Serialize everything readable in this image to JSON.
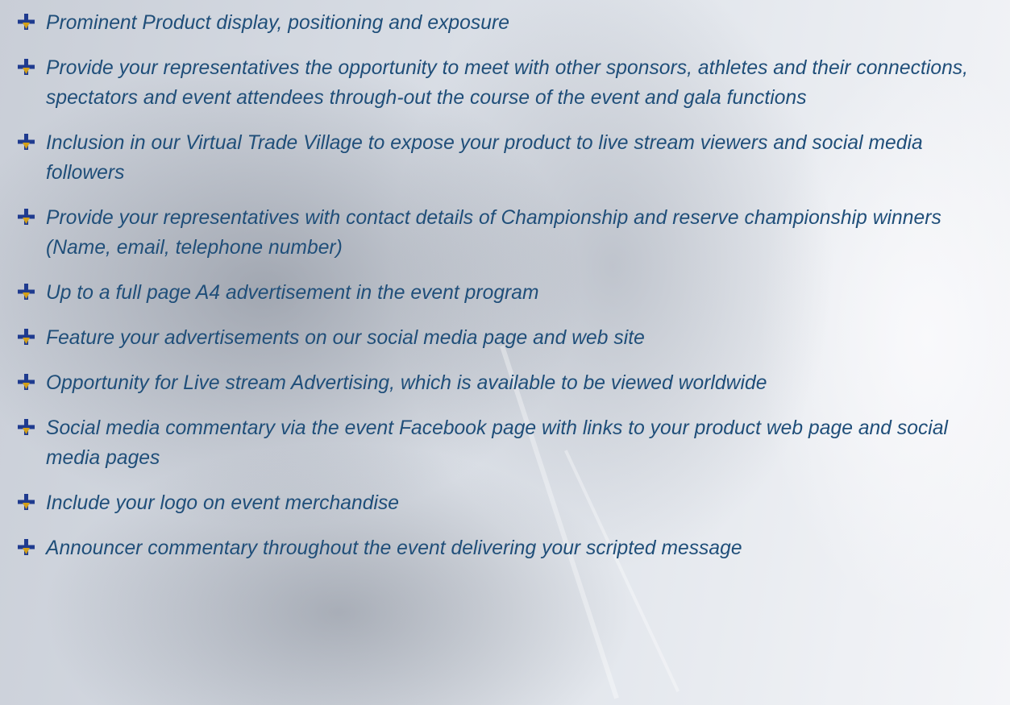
{
  "bullet_icon": "arrow-down-plus-bullet-icon",
  "colors": {
    "text": "#1f4e79",
    "bullet_plus": "#1f3b8f",
    "bullet_arrow": "#d4a017"
  },
  "items": [
    {
      "text": "Prominent Product display, positioning and exposure"
    },
    {
      "text": "Provide your representatives the opportunity to meet with other sponsors, athletes and their connections, spectators and event attendees through-out the course of the event and gala functions"
    },
    {
      "text": "Inclusion in our Virtual Trade Village to expose your product to live stream viewers and social media followers"
    },
    {
      "text": "Provide your representatives with contact details of Championship and reserve championship winners (Name, email, telephone number)"
    },
    {
      "text": "Up to a full page A4 advertisement in the event program"
    },
    {
      "text": "Feature your advertisements on our social media page and web site"
    },
    {
      "text": "Opportunity for Live stream Advertising, which is available to be viewed worldwide"
    },
    {
      "text": "Social media commentary via the event Facebook page with links to your product web page and social media pages"
    },
    {
      "text": "Include your logo on event merchandise"
    },
    {
      "text": "Announcer commentary throughout the event delivering your scripted message"
    }
  ]
}
